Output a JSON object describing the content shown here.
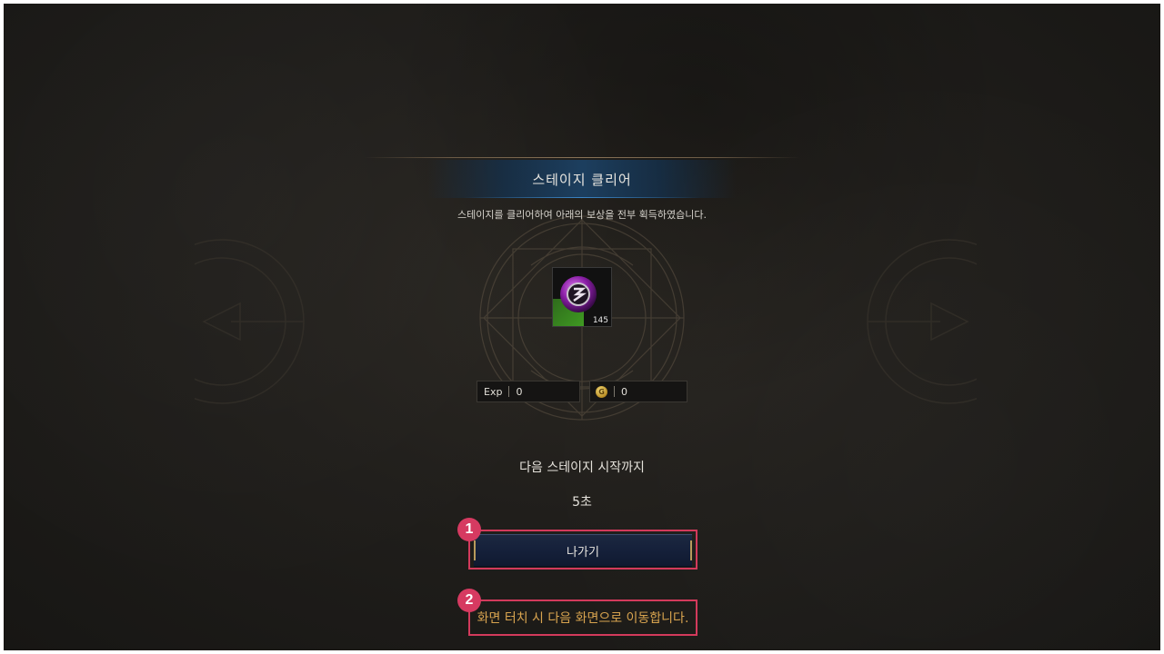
{
  "dialog": {
    "title": "스테이지 클리어",
    "subtitle": "스테이지를 클리어하여 아래의 보상을 전부 획득하였습니다."
  },
  "reward_item": {
    "icon": "purple-gem-icon",
    "count": "145"
  },
  "rewards": {
    "exp_label": "Exp",
    "exp_value": "0",
    "gold_icon": "gold-coin-icon",
    "gold_value": "0"
  },
  "next_stage": {
    "label": "다음 스테이지 시작까지",
    "countdown": "5초"
  },
  "exit_button": {
    "label": "나가기"
  },
  "touch_hint": "화면 터치 시 다음 화면으로 이동합니다.",
  "annotations": {
    "badge_1": "1",
    "badge_2": "2"
  },
  "colors": {
    "accent_red": "#d33a5c",
    "hint_gold": "#d9a44f",
    "title_band_blue": "#1c4266"
  }
}
